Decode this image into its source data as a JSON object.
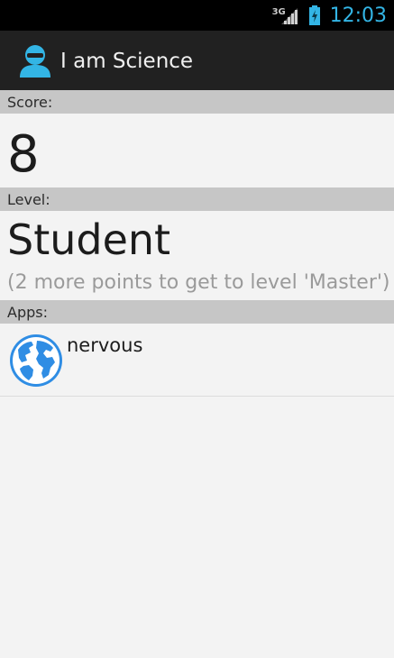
{
  "status_bar": {
    "network": "3G",
    "time": "12:03",
    "icons": [
      "signal-icon",
      "battery-charging-icon"
    ]
  },
  "action_bar": {
    "title": "I am Science",
    "icon": "person-icon"
  },
  "score": {
    "header": "Score:",
    "value": "8"
  },
  "level": {
    "header": "Level:",
    "value": "Student",
    "hint": "(2 more points to get to level 'Master')"
  },
  "apps": {
    "header": "Apps:",
    "items": [
      {
        "name": "nervous",
        "icon": "globe-icon"
      }
    ]
  },
  "colors": {
    "accent": "#33b5e5",
    "action_bar": "#212121",
    "section_header": "#c6c6c6",
    "background": "#f3f3f3"
  }
}
